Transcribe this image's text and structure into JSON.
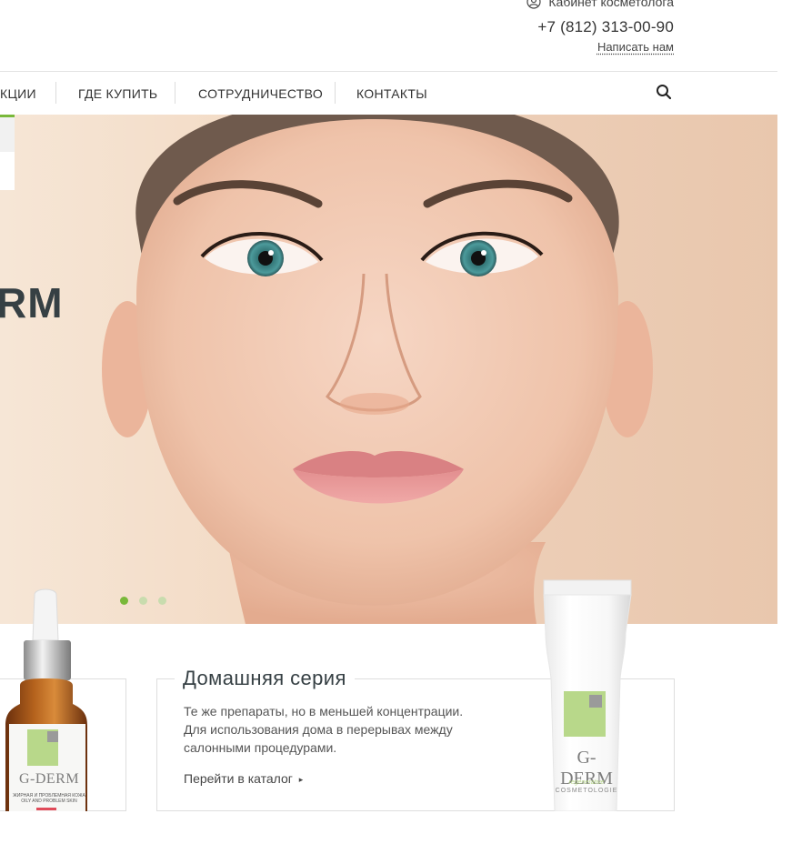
{
  "header": {
    "account_label": "Кабинет косметолога",
    "phone": "+7 (812) 313-00-90",
    "write_label": "Написать нам"
  },
  "nav": {
    "items": [
      {
        "label": "КЦИИ"
      },
      {
        "label": "ГДЕ КУПИТЬ"
      },
      {
        "label": "СОТРУДНИЧЕСТВО"
      },
      {
        "label": "КОНТАКТЫ"
      }
    ],
    "search_icon": "search-icon"
  },
  "hero": {
    "title_fragment": "RM",
    "slides_total": 3,
    "active_slide": 1
  },
  "home_series": {
    "title": "Домашняя серия",
    "line1": "Те же препараты, но в меньшей концентрации.",
    "line2": "Для использования дома в перерывах между",
    "line3": "салонными процедурами.",
    "link_label": "Перейти в каталог",
    "link_arrow": "▸"
  },
  "products": {
    "bottle_brand": "G-DERM",
    "bottle_caption_line1": "ЖИРНАЯ И ПРОБЛЕМНАЯ КОЖА",
    "bottle_caption_line2": "OILY AND PROBLEM SKIN",
    "tube_brand": "G-DERM",
    "tube_caption_line1": "regenerative",
    "tube_caption_line2": "COSMETOLOGIE"
  },
  "colors": {
    "accent_green": "#79b83a",
    "dot_inactive": "#c8dcae",
    "heading": "#364044"
  }
}
